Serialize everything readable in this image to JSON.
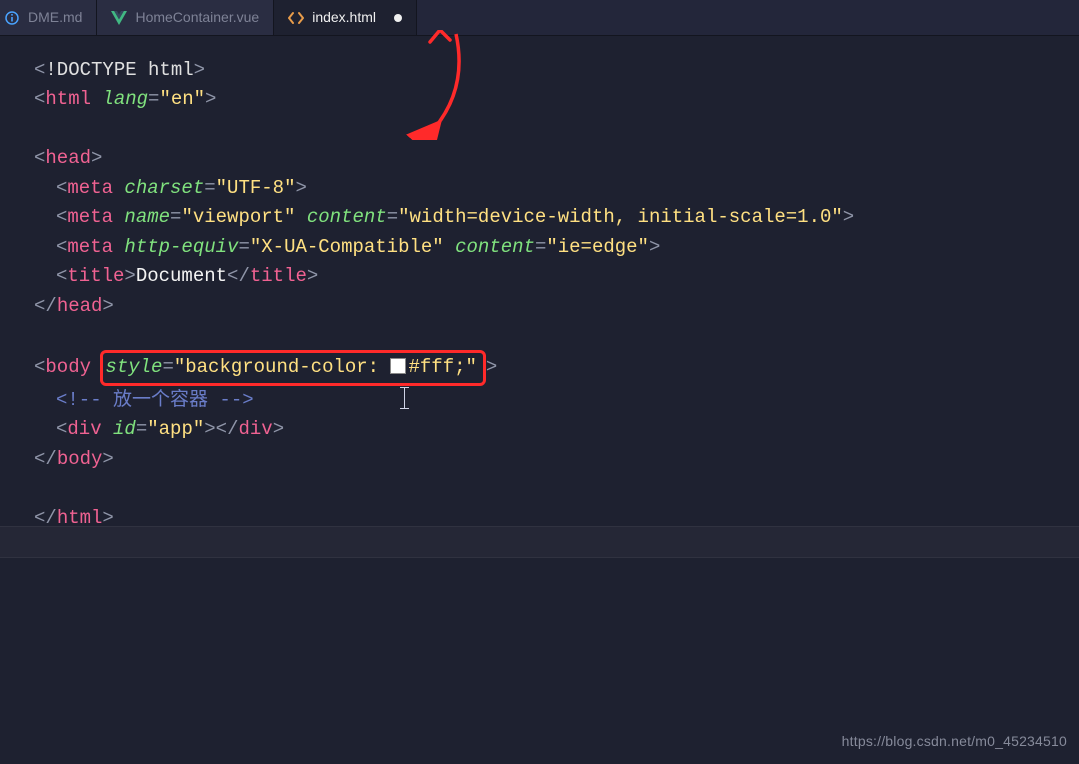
{
  "tabs": [
    {
      "label": "DME.md",
      "icon": "info-icon",
      "active": false,
      "cutoff": true
    },
    {
      "label": "HomeContainer.vue",
      "icon": "vue-icon",
      "active": false,
      "cutoff": false
    },
    {
      "label": "index.html",
      "icon": "code-icon",
      "active": true,
      "cutoff": false,
      "dirty": true
    }
  ],
  "code": {
    "doctype": "<!DOCTYPE html>",
    "html_tag": "html",
    "html_attr": "lang",
    "html_val": "\"en\"",
    "head_tag": "head",
    "meta1_tag": "meta",
    "meta1_attr": "charset",
    "meta1_val": "\"UTF-8\"",
    "meta2_tag": "meta",
    "meta2_a1": "name",
    "meta2_v1": "\"viewport\"",
    "meta2_a2": "content",
    "meta2_v2": "\"width=device-width, initial-scale=1.0\"",
    "meta3_tag": "meta",
    "meta3_a1": "http-equiv",
    "meta3_v1": "\"X-UA-Compatible\"",
    "meta3_a2": "content",
    "meta3_v2": "\"ie=edge\"",
    "title_tag": "title",
    "title_text": "Document",
    "body_tag": "body",
    "body_attr": "style",
    "body_val_pre": "\"background-color: ",
    "body_val_post": "#fff;\"",
    "comment": "<!-- 放一个容器 -->",
    "div_tag": "div",
    "div_attr": "id",
    "div_val": "\"app\""
  },
  "watermark": "https://blog.csdn.net/m0_45234510"
}
